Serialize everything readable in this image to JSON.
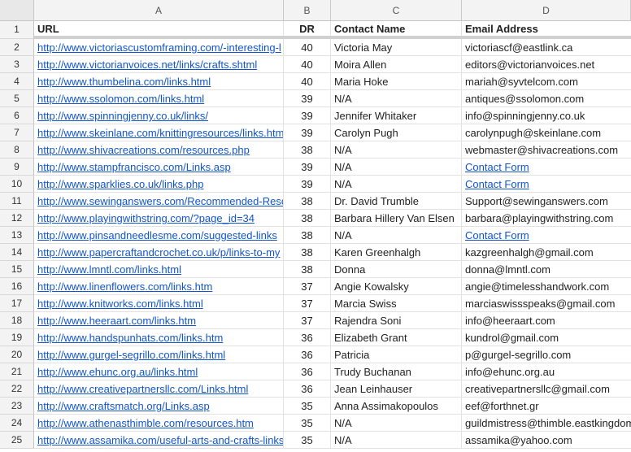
{
  "columns": [
    "A",
    "B",
    "C",
    "D"
  ],
  "header": {
    "row_number": "1",
    "url": "URL",
    "dr": "DR",
    "contact_name": "Contact Name",
    "email": "Email Address"
  },
  "rows": [
    {
      "num": "2",
      "url": "http://www.victoriascustomframing.com/-interesting-l",
      "dr": "40",
      "name": "Victoria May",
      "email": "victoriascf@eastlink.ca",
      "email_is_link": false
    },
    {
      "num": "3",
      "url": "http://www.victorianvoices.net/links/crafts.shtml",
      "dr": "40",
      "name": "Moira Allen",
      "email": "editors@victorianvoices.net",
      "email_is_link": false
    },
    {
      "num": "4",
      "url": "http://www.thumbelina.com/links.html",
      "dr": "40",
      "name": "Maria Hoke",
      "email": "mariah@syvtelcom.com",
      "email_is_link": false
    },
    {
      "num": "5",
      "url": "http://www.ssolomon.com/links.html",
      "dr": "39",
      "name": "N/A",
      "email": "antiques@ssolomon.com",
      "email_is_link": false
    },
    {
      "num": "6",
      "url": "http://www.spinningjenny.co.uk/links/",
      "dr": "39",
      "name": "Jennifer Whitaker",
      "email": "info@spinningjenny.co.uk",
      "email_is_link": false
    },
    {
      "num": "7",
      "url": "http://www.skeinlane.com/knittingresources/links.htm",
      "dr": "39",
      "name": "Carolyn Pugh",
      "email": "carolynpugh@skeinlane.com",
      "email_is_link": false
    },
    {
      "num": "8",
      "url": "http://www.shivacreations.com/resources.php",
      "dr": "38",
      "name": "N/A",
      "email": "webmaster@shivacreations.com",
      "email_is_link": false
    },
    {
      "num": "9",
      "url": "http://www.stampfrancisco.com/Links.asp",
      "dr": "39",
      "name": "N/A",
      "email": "Contact Form",
      "email_is_link": true
    },
    {
      "num": "10",
      "url": "http://www.sparklies.co.uk/links.php",
      "dr": "39",
      "name": "N/A",
      "email": "Contact Form",
      "email_is_link": true
    },
    {
      "num": "11",
      "url": "http://www.sewinganswers.com/Recommended-Reso",
      "dr": "38",
      "name": "Dr. David Trumble",
      "email": "Support@sewinganswers.com",
      "email_is_link": false
    },
    {
      "num": "12",
      "url": "http://www.playingwithstring.com/?page_id=34",
      "dr": "38",
      "name": "Barbara Hillery Van Elsen",
      "email": "barbara@playingwithstring.com",
      "email_is_link": false
    },
    {
      "num": "13",
      "url": "http://www.pinsandneedlesme.com/suggested-links",
      "dr": "38",
      "name": "N/A",
      "email": "Contact Form",
      "email_is_link": true
    },
    {
      "num": "14",
      "url": "http://www.papercraftandcrochet.co.uk/p/links-to-my",
      "dr": "38",
      "name": "Karen Greenhalgh",
      "email": "kazgreenhalgh@gmail.com",
      "email_is_link": false
    },
    {
      "num": "15",
      "url": "http://www.lmntl.com/links.html",
      "dr": "38",
      "name": "Donna",
      "email": "donna@lmntl.com",
      "email_is_link": false
    },
    {
      "num": "16",
      "url": "http://www.linenflowers.com/links.htm",
      "dr": "37",
      "name": "Angie Kowalsky",
      "email": "angie@timelesshandwork.com",
      "email_is_link": false
    },
    {
      "num": "17",
      "url": "http://www.knitworks.com/links.html",
      "dr": "37",
      "name": "Marcia Swiss",
      "email": "marciaswissspeaks@gmail.com",
      "email_is_link": false
    },
    {
      "num": "18",
      "url": "http://www.heeraart.com/links.htm",
      "dr": "37",
      "name": "Rajendra Soni",
      "email": "info@heeraart.com",
      "email_is_link": false
    },
    {
      "num": "19",
      "url": "http://www.handspunhats.com/links.htm",
      "dr": "36",
      "name": "Elizabeth Grant",
      "email": "kundrol@gmail.com",
      "email_is_link": false
    },
    {
      "num": "20",
      "url": "http://www.gurgel-segrillo.com/links.html",
      "dr": "36",
      "name": "Patricia",
      "email": "p@gurgel-segrillo.com",
      "email_is_link": false
    },
    {
      "num": "21",
      "url": "http://www.ehunc.org.au/links.html",
      "dr": "36",
      "name": "Trudy Buchanan",
      "email": "info@ehunc.org.au",
      "email_is_link": false
    },
    {
      "num": "22",
      "url": "http://www.creativepartnersllc.com/Links.html",
      "dr": "36",
      "name": "Jean Leinhauser",
      "email": "creativepartnersllc@gmail.com",
      "email_is_link": false
    },
    {
      "num": "23",
      "url": "http://www.craftsmatch.org/Links.asp",
      "dr": "35",
      "name": "Anna Assimakopoulos",
      "email": "eef@forthnet.gr",
      "email_is_link": false
    },
    {
      "num": "24",
      "url": "http://www.athenasthimble.com/resources.htm",
      "dr": "35",
      "name": "N/A",
      "email": "guildmistress@thimble.eastkingdom",
      "email_is_link": false
    },
    {
      "num": "25",
      "url": "http://www.assamika.com/useful-arts-and-crafts-links",
      "dr": "35",
      "name": "N/A",
      "email": "assamika@yahoo.com",
      "email_is_link": false
    }
  ]
}
